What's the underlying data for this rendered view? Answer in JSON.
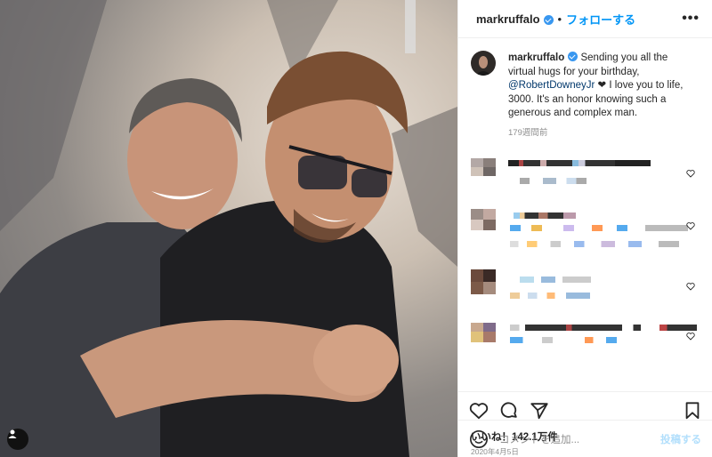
{
  "post": {
    "username": "markruffalo",
    "follow_label": "フォローする",
    "separator": "•",
    "more_icon": "more-dots-icon",
    "caption_user": "markruffalo",
    "caption_text_1": " Sending you all the virtual hugs for your birthday, ",
    "caption_mention": "@RobertDowneyJr",
    "caption_text_2": " ❤ I love you to life, 3000. It's an honor knowing such a generous and complex man.",
    "caption_ago": "179週間前",
    "likes": "いいね！142.1万件",
    "date": "2020年4月5日",
    "comment_placeholder": "コメントを追加...",
    "post_button": "投稿する"
  },
  "colors": {
    "follow": "#0095f6",
    "verified": "#3897f0",
    "post_button_disabled": "#b2dffc"
  },
  "icons": [
    "heart-icon",
    "comment-icon",
    "share-icon",
    "bookmark-icon",
    "emoji-icon",
    "user-tag-icon"
  ]
}
